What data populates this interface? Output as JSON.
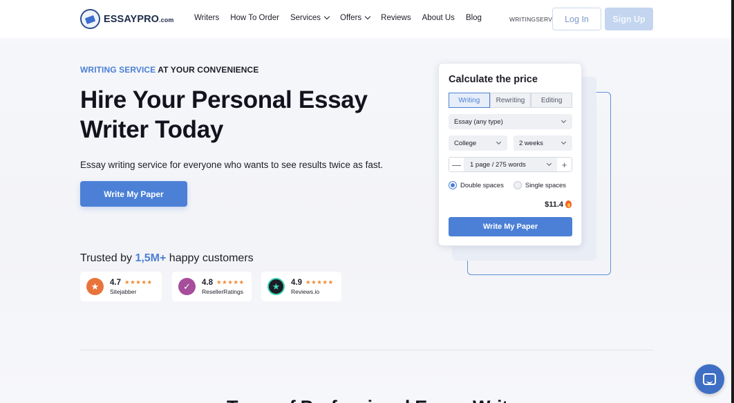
{
  "header": {
    "logo": {
      "name": "ESSAYPRO",
      "domain": ".com"
    },
    "nav": [
      {
        "label": "Writers",
        "dropdown": false
      },
      {
        "label": "How To Order",
        "dropdown": false
      },
      {
        "label": "Services",
        "dropdown": true
      },
      {
        "label": "Offers",
        "dropdown": true
      },
      {
        "label": "Reviews",
        "dropdown": false
      },
      {
        "label": "About Us",
        "dropdown": false
      },
      {
        "label": "Blog",
        "dropdown": false
      }
    ],
    "promo_code": "WRITINGSERV",
    "login_label": "Log In",
    "signup_label": "Sign Up"
  },
  "hero": {
    "eyebrow_accent": "WRITING SERVICE",
    "eyebrow_rest": " AT YOUR CONVENIENCE",
    "title": "Hire Your Personal Essay Writer Today",
    "subtitle": "Essay writing service for everyone who wants to see results twice as fast.",
    "cta_label": "Write My Paper"
  },
  "trust": {
    "prefix": "Trusted by ",
    "count": "1,5M+",
    "suffix": " happy customers",
    "ratings": [
      {
        "score": "4.7",
        "name": "Sitejabber",
        "stars": "★★★★★",
        "icon": "star-badge-icon",
        "color": "#e8743b"
      },
      {
        "score": "4.8",
        "name": "ResellerRatings",
        "stars": "★★★★★",
        "icon": "check-badge-icon",
        "color": "#a64d9c"
      },
      {
        "score": "4.9",
        "name": "Reviews.io",
        "stars": "★★★★★",
        "icon": "star-circle-icon",
        "color": "#1c1d26"
      }
    ]
  },
  "calculator": {
    "title": "Calculate the price",
    "tabs": [
      {
        "label": "Writing",
        "active": true
      },
      {
        "label": "Rewriting",
        "active": false
      },
      {
        "label": "Editing",
        "active": false
      }
    ],
    "paper_type": "Essay (any type)",
    "level": "College",
    "deadline": "2 weeks",
    "pages": "1 page / 275 words",
    "minus": "—",
    "plus": "+",
    "spacing_options": [
      {
        "label": "Double spaces",
        "selected": true
      },
      {
        "label": "Single spaces",
        "selected": false
      }
    ],
    "price": "$11.4",
    "cta_label": "Write My Paper"
  },
  "next_section_heading": "Team of Professional Essay Writers",
  "colors": {
    "accent": "#4b80d6",
    "text": "#1c1d26",
    "signup_bg": "#c3d5ef"
  }
}
